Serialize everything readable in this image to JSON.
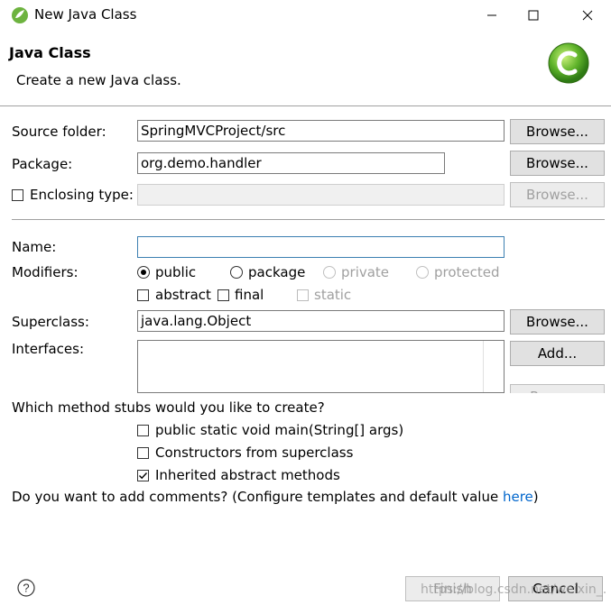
{
  "window": {
    "title": "New Java Class"
  },
  "header": {
    "title": "Java Class",
    "description": "Create a new Java class."
  },
  "source_folder": {
    "label": "Source folder:",
    "value": "SpringMVCProject/src",
    "browse": "Browse..."
  },
  "package": {
    "label": "Package:",
    "value": "org.demo.handler",
    "browse": "Browse..."
  },
  "enclosing": {
    "label": "Enclosing type:",
    "value": "",
    "browse": "Browse..."
  },
  "name": {
    "label": "Name:",
    "value": ""
  },
  "modifiers": {
    "label": "Modifiers:",
    "public": "public",
    "package": "package",
    "private": "private",
    "protected": "protected",
    "abstract": "abstract",
    "final": "final",
    "static": "static"
  },
  "superclass": {
    "label": "Superclass:",
    "value": "java.lang.Object",
    "browse": "Browse..."
  },
  "interfaces": {
    "label": "Interfaces:",
    "add": "Add...",
    "remove": "Remove"
  },
  "stubs": {
    "question": "Which method stubs would you like to create?",
    "main": "public static void main(String[] args)",
    "constructors": "Constructors from superclass",
    "inherited": "Inherited abstract methods"
  },
  "comments": {
    "question": "Do you want to add comments? (Configure templates and default value ",
    "link": "here",
    "close": ")"
  },
  "footer": {
    "finish": "Finish",
    "cancel": "Cancel",
    "watermark": "https://blog.csdn.net/weixin_..."
  },
  "colors": {
    "accent": "#3c7fb1",
    "link": "#0066cc",
    "spring_green": "#6db33f"
  }
}
